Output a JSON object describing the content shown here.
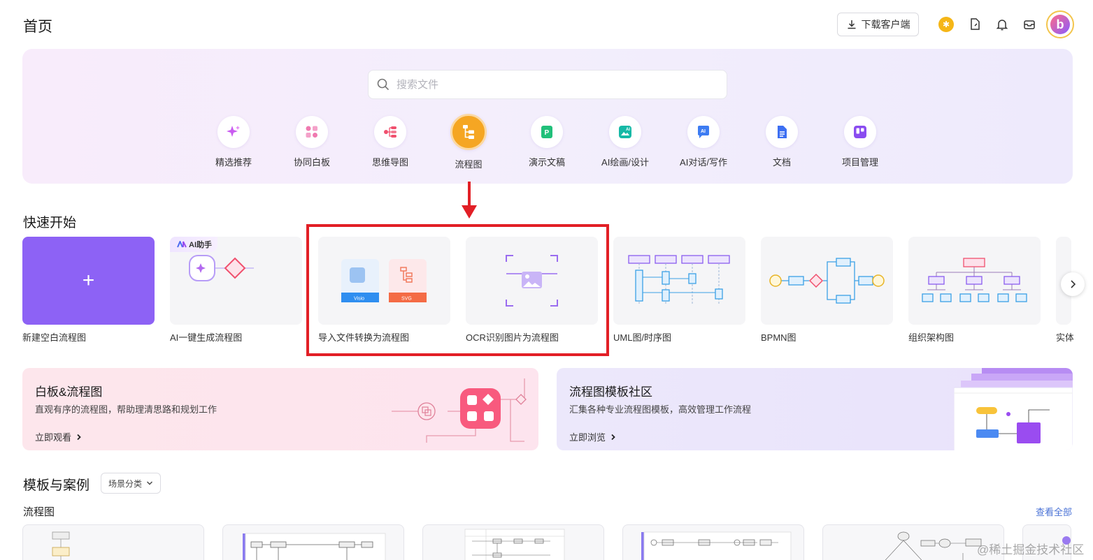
{
  "header": {
    "title": "首页",
    "download_label": "下载客户端"
  },
  "search": {
    "placeholder": "搜索文件"
  },
  "categories": [
    {
      "label": "精选推荐",
      "icon": "sparkle-icon"
    },
    {
      "label": "协同白板",
      "icon": "whiteboard-icon"
    },
    {
      "label": "思维导图",
      "icon": "mindmap-icon"
    },
    {
      "label": "流程图",
      "icon": "flowchart-icon",
      "active": true
    },
    {
      "label": "演示文稿",
      "icon": "presentation-icon"
    },
    {
      "label": "AI绘画/设计",
      "icon": "ai-paint-icon"
    },
    {
      "label": "AI对话/写作",
      "icon": "ai-chat-icon"
    },
    {
      "label": "文档",
      "icon": "document-icon"
    },
    {
      "label": "项目管理",
      "icon": "project-icon"
    }
  ],
  "quick_start": {
    "title": "快速开始",
    "ai_badge": "AI助手",
    "visio_tag": "Visio",
    "svg_tag": "SVG",
    "cards": [
      {
        "label": "新建空白流程图"
      },
      {
        "label": "AI一键生成流程图"
      },
      {
        "label": "导入文件转换为流程图"
      },
      {
        "label": "OCR识别图片为流程图"
      },
      {
        "label": "UML图/时序图"
      },
      {
        "label": "BPMN图"
      },
      {
        "label": "组织架构图"
      },
      {
        "label": "实体"
      }
    ]
  },
  "banners": {
    "left": {
      "title": "白板&流程图",
      "subtitle": "直观有序的流程图，帮助理清思路和规划工作",
      "link": "立即观看"
    },
    "right": {
      "title": "流程图模板社区",
      "subtitle": "汇集各种专业流程图模板，高效管理工作流程",
      "link": "立即浏览"
    }
  },
  "templates": {
    "title": "模板与案例",
    "scene_select": "场景分类",
    "subsection": "流程图",
    "view_all": "查看全部"
  },
  "watermark": "@稀土掘金技术社区",
  "colors": {
    "accent_purple": "#8d62f5",
    "active_orange": "#f5a623",
    "highlight_red": "#e21f26",
    "link_blue": "#4a72d6"
  }
}
